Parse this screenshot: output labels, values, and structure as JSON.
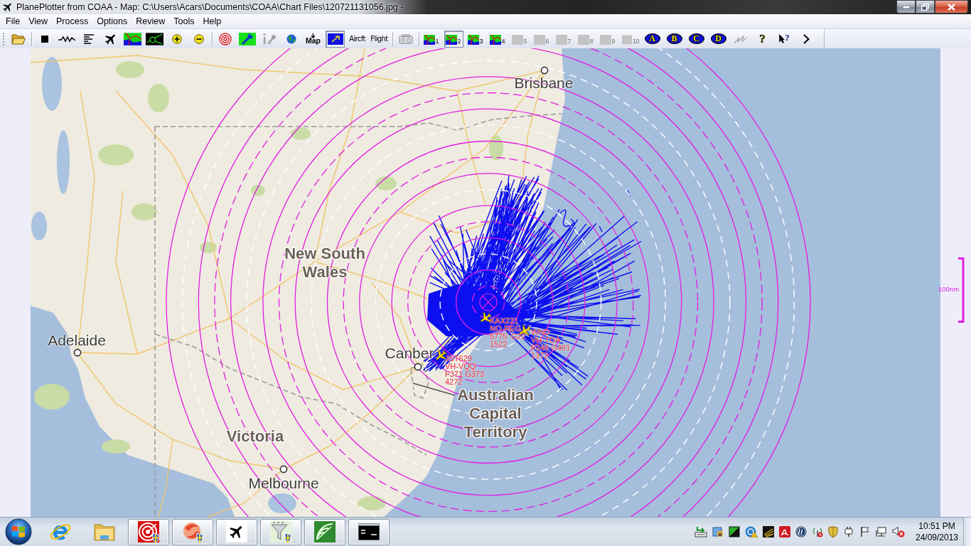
{
  "window": {
    "title": "PlanePlotter from COAA - Map: C:\\Users\\Acars\\Documents\\COAA\\Chart Files\\120721131056.jpg -"
  },
  "menu": [
    "File",
    "View",
    "Process",
    "Options",
    "Review",
    "Tools",
    "Help"
  ],
  "toolbar": {
    "items": [
      {
        "kind": "icon",
        "selected": false
      },
      {
        "kind": "separator"
      },
      {
        "kind": "icon",
        "selected": false
      },
      {
        "kind": "icon",
        "selected": false
      },
      {
        "kind": "icon",
        "selected": false
      },
      {
        "kind": "icon",
        "selected": false
      },
      {
        "kind": "icon",
        "selected": false
      },
      {
        "kind": "icon",
        "selected": false
      },
      {
        "kind": "icon",
        "selected": false
      },
      {
        "kind": "icon",
        "selected": false
      },
      {
        "kind": "separator"
      },
      {
        "kind": "icon",
        "selected": false
      },
      {
        "kind": "icon",
        "selected": false
      },
      {
        "kind": "icon",
        "selected": false
      },
      {
        "kind": "icon",
        "selected": false
      },
      {
        "kind": "download",
        "label": "Map",
        "selected": false
      },
      {
        "kind": "icon",
        "selected": true
      },
      {
        "kind": "text",
        "label": "Aircft",
        "selected": false
      },
      {
        "kind": "text",
        "label": "Flight",
        "selected": false
      },
      {
        "kind": "separator"
      },
      {
        "kind": "icon",
        "selected": false
      },
      {
        "kind": "separator"
      },
      {
        "kind": "preset",
        "label": "1",
        "selected": false,
        "disabled": false
      },
      {
        "kind": "preset",
        "label": "2",
        "selected": true,
        "disabled": false
      },
      {
        "kind": "preset",
        "label": "3",
        "selected": false,
        "disabled": false
      },
      {
        "kind": "preset",
        "label": "4",
        "selected": false,
        "disabled": false
      },
      {
        "kind": "preset",
        "label": "5",
        "selected": false,
        "disabled": true
      },
      {
        "kind": "preset",
        "label": "6",
        "selected": false,
        "disabled": true
      },
      {
        "kind": "preset",
        "label": "7",
        "selected": false,
        "disabled": true
      },
      {
        "kind": "preset",
        "label": "8",
        "selected": false,
        "disabled": true
      },
      {
        "kind": "preset",
        "label": "9",
        "selected": false,
        "disabled": true
      },
      {
        "kind": "preset",
        "label": "10",
        "selected": false,
        "disabled": true
      },
      {
        "kind": "letter",
        "label": "A",
        "selected": false
      },
      {
        "kind": "letter",
        "label": "B",
        "selected": false
      },
      {
        "kind": "letter",
        "label": "C",
        "selected": false
      },
      {
        "kind": "letter",
        "label": "D",
        "selected": false
      },
      {
        "kind": "icon",
        "selected": false
      },
      {
        "kind": "glyph",
        "label": "?",
        "selected": false
      },
      {
        "kind": "pointer",
        "label": "?",
        "selected": false
      },
      {
        "kind": "icon",
        "selected": false
      }
    ]
  },
  "map": {
    "labels": [
      {
        "kind": "city",
        "name": "Brisbane"
      },
      {
        "kind": "region",
        "name": "New South Wales"
      },
      {
        "kind": "city",
        "name": "Adelaide"
      },
      {
        "kind": "city",
        "name": "Canber"
      },
      {
        "kind": "region",
        "name": "Victoria"
      },
      {
        "kind": "region",
        "name": "Australian Capital Territory"
      },
      {
        "kind": "city",
        "name": "Melbourne"
      }
    ],
    "aircraft": [
      {
        "callsign": "KAX221",
        "registration": "NO-REG",
        "flight_info": "5775' G22",
        "code": "1522"
      },
      {
        "callsign": "WND",
        "registration": "VH-TOA",
        "flight_info": "F248 G491",
        "code": "1372"
      },
      {
        "callsign": "JST629",
        "registration": "VH-VQQ",
        "flight_info": "F371 G373",
        "code": "4272"
      }
    ],
    "scale": {
      "label": "100nm"
    }
  },
  "taskbar": {
    "apps": [
      {
        "running": false
      },
      {
        "running": false
      },
      {
        "running": true
      },
      {
        "running": true
      },
      {
        "running": true
      },
      {
        "running": true
      },
      {
        "running": true
      },
      {
        "running": true
      }
    ],
    "clock": {
      "time": "10:51 PM",
      "date": "24/09/2013"
    }
  }
}
